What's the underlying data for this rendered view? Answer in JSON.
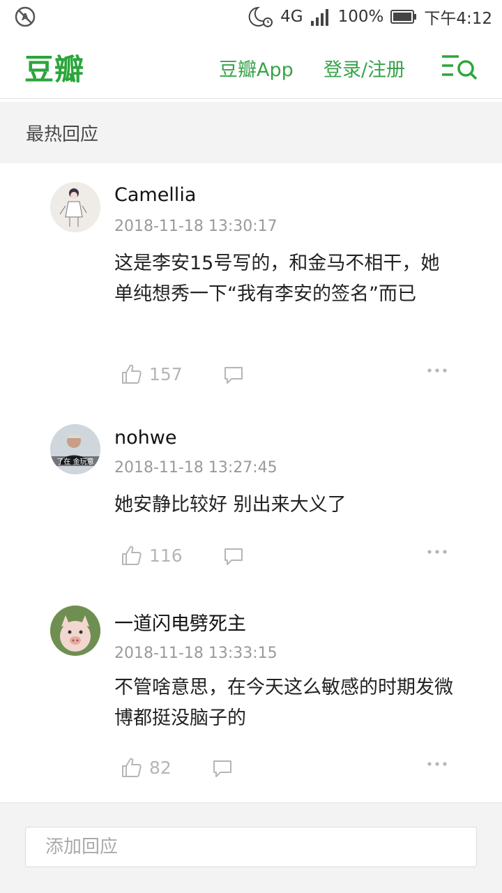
{
  "status_bar": {
    "battery": "100%",
    "network": "4G",
    "time": "下午4:12"
  },
  "nav": {
    "logo": "豆瓣",
    "app_link": "豆瓣App",
    "login_link": "登录/注册"
  },
  "section": {
    "title": "最热回应"
  },
  "comments": [
    {
      "author": "Camellia",
      "time": "2018-11-18 13:30:17",
      "content": "这是李安15号写的，和金马不相干，她单纯想秀一下“我有李安的签名”而已",
      "likes": "157"
    },
    {
      "author": "nohwe",
      "time": "2018-11-18 13:27:45",
      "content": "她安静比较好 别出来大义了",
      "likes": "116",
      "avatar_caption": "了在 金玩意"
    },
    {
      "author": "一道闪电劈死主",
      "time": "2018-11-18 13:33:15",
      "content": "不管啥意思，在今天这么敏感的时期发微博都挺没脑子的",
      "likes": "82"
    }
  ],
  "reply_box": {
    "placeholder": "添加回应"
  },
  "colors": {
    "brand_green": "#2aa63b",
    "link_green": "#37a34a",
    "muted_gray": "#9a9a9a",
    "section_bg": "#f3f3f3"
  }
}
